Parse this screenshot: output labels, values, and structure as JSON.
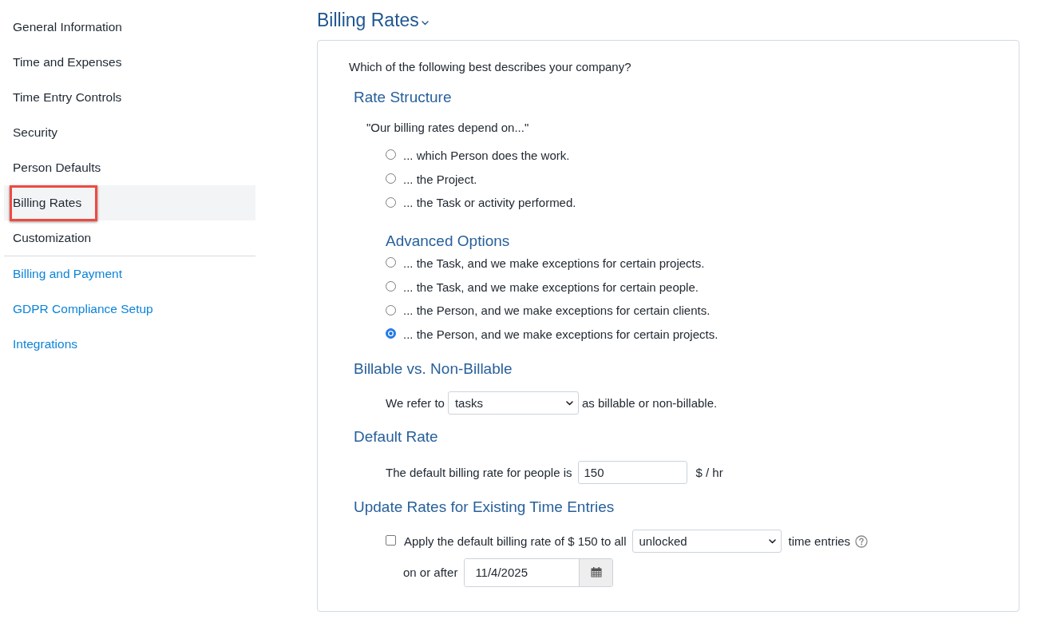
{
  "sidebar": {
    "items": [
      {
        "label": "General Information",
        "selected": false,
        "highlighted": false
      },
      {
        "label": "Time and Expenses",
        "selected": false,
        "highlighted": false
      },
      {
        "label": "Time Entry Controls",
        "selected": false,
        "highlighted": false
      },
      {
        "label": "Security",
        "selected": false,
        "highlighted": false
      },
      {
        "label": "Person Defaults",
        "selected": false,
        "highlighted": false
      },
      {
        "label": "Billing Rates",
        "selected": true,
        "highlighted": true
      },
      {
        "label": "Customization",
        "selected": false,
        "highlighted": false
      }
    ],
    "links": [
      {
        "label": "Billing and Payment"
      },
      {
        "label": "GDPR Compliance Setup"
      },
      {
        "label": "Integrations"
      }
    ]
  },
  "title": "Billing Rates",
  "card": {
    "question": "Which of the following best describes your company?",
    "rate_structure": {
      "heading": "Rate Structure",
      "quote": "\"Our billing rates depend on...\"",
      "options": [
        {
          "label": "... which Person does the work.",
          "selected": false
        },
        {
          "label": "... the Project.",
          "selected": false
        },
        {
          "label": "... the Task or activity performed.",
          "selected": false
        }
      ],
      "advanced": {
        "heading": "Advanced Options",
        "options": [
          {
            "label": "... the Task, and we make exceptions for certain projects.",
            "selected": false
          },
          {
            "label": "... the Task, and we make exceptions for certain people.",
            "selected": false
          },
          {
            "label": "... the Person, and we make exceptions for certain clients.",
            "selected": false
          },
          {
            "label": "... the Person, and we make exceptions for certain projects.",
            "selected": true
          }
        ]
      }
    },
    "billable": {
      "heading": "Billable vs. Non-Billable",
      "prefix": "We refer to",
      "select_value": "tasks",
      "suffix": "as billable or non-billable."
    },
    "default_rate": {
      "heading": "Default Rate",
      "label": "The default billing rate for people is",
      "value": "150",
      "unit": "$ / hr"
    },
    "update_rates": {
      "heading": "Update Rates for Existing Time Entries",
      "checked": false,
      "label": "Apply the default billing rate of $ 150 to all",
      "select_value": "unlocked",
      "suffix": "time entries",
      "date_label": "on or after",
      "date_value": "11/4/2025"
    }
  }
}
